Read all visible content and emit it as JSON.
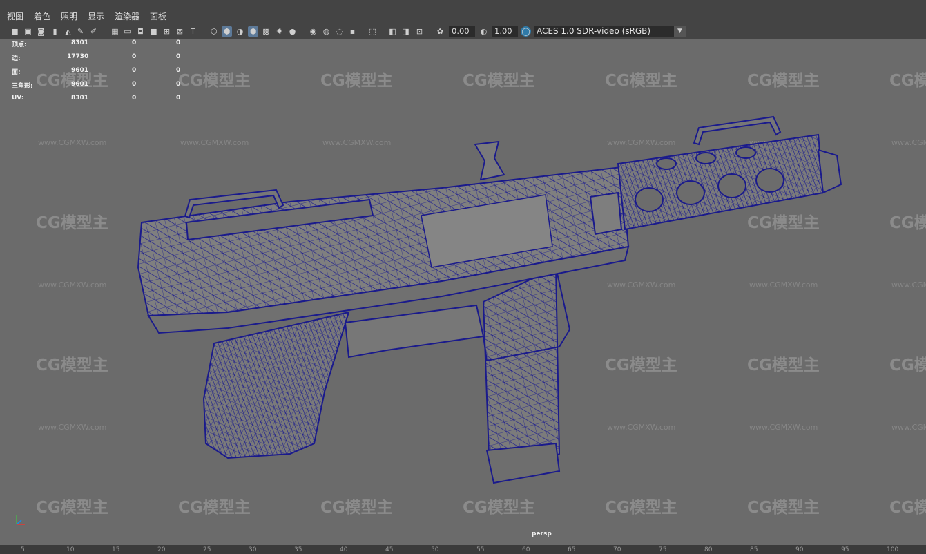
{
  "menus": [
    "视图",
    "着色",
    "照明",
    "显示",
    "渲染器",
    "面板"
  ],
  "toolbar": {
    "exposure_value": "0.00",
    "gamma_value": "1.00",
    "colorspace": "ACES 1.0 SDR-video (sRGB)",
    "icons": [
      "camera-icon",
      "camera-attributes-icon",
      "image-plane-icon",
      "bookmark-icon",
      "2d-pan-icon",
      "grease-pencil-icon",
      "grid-icon",
      "film-gate-icon",
      "resolution-gate-icon",
      "gate-mask-icon",
      "field-chart-icon",
      "safe-title-icon",
      "wireframe-icon",
      "smooth-shade-icon",
      "default-material-icon",
      "wireframe-on-shaded-icon",
      "xray-icon",
      "textured-icon",
      "use-all-lights-icon",
      "shadows-icon",
      "screen-space-ao-icon",
      "motion-blur-icon",
      "multisample-aa-icon",
      "depth-of-field-icon",
      "isolate-select-icon",
      "xray-joints-icon",
      "xray-active-icon",
      "backface-culling-icon",
      "exposure-icon",
      "gamma-icon",
      "view-transform-icon"
    ]
  },
  "hud": {
    "rows": [
      {
        "label": "顶点:",
        "v1": "8301",
        "v2": "0",
        "v3": "0"
      },
      {
        "label": "边:",
        "v1": "17730",
        "v2": "0",
        "v3": "0"
      },
      {
        "label": "面:",
        "v1": "9601",
        "v2": "0",
        "v3": "0"
      },
      {
        "label": "三角形:",
        "v1": "9601",
        "v2": "0",
        "v3": "0"
      },
      {
        "label": "UV:",
        "v1": "8301",
        "v2": "0",
        "v3": "0"
      }
    ]
  },
  "viewport": {
    "camera_label": "persp",
    "wireframe_color": "#1a1a8c",
    "model_fill": "#7c7c7c",
    "background": "#6b6b6b"
  },
  "watermark": {
    "logo": "CG模型主",
    "url": "www.CGMXW.com"
  },
  "timeline_ticks": [
    "5",
    "10",
    "15",
    "20",
    "25",
    "30",
    "35",
    "40",
    "45",
    "50",
    "55",
    "60",
    "65",
    "70",
    "75",
    "80",
    "85",
    "90",
    "95",
    "100"
  ]
}
